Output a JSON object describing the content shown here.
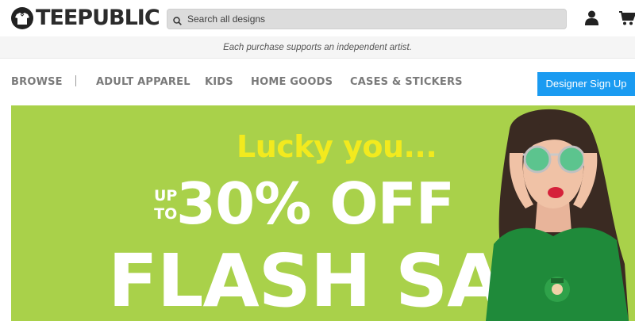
{
  "header": {
    "logo_text": "TEEPUBLIC",
    "search_placeholder": "Search all designs",
    "icons": [
      "search-icon",
      "user-icon",
      "cart-icon"
    ]
  },
  "tagline": "Each purchase supports an independent artist.",
  "nav": {
    "items": [
      "BROWSE",
      "ADULT APPAREL",
      "KIDS",
      "HOME GOODS",
      "CASES & STICKERS"
    ],
    "signup_label": "Designer Sign Up"
  },
  "hero": {
    "headline": "Lucky you...",
    "upto_line1": "UP",
    "upto_line2": "TO",
    "discount": "30% OFF",
    "sale": "FLASH SALE"
  },
  "colors": {
    "accent_blue": "#1a9bf1",
    "hero_green": "#a9d14a",
    "headline_yellow": "#f2ea1e",
    "nav_gray": "#7a7a7a"
  }
}
